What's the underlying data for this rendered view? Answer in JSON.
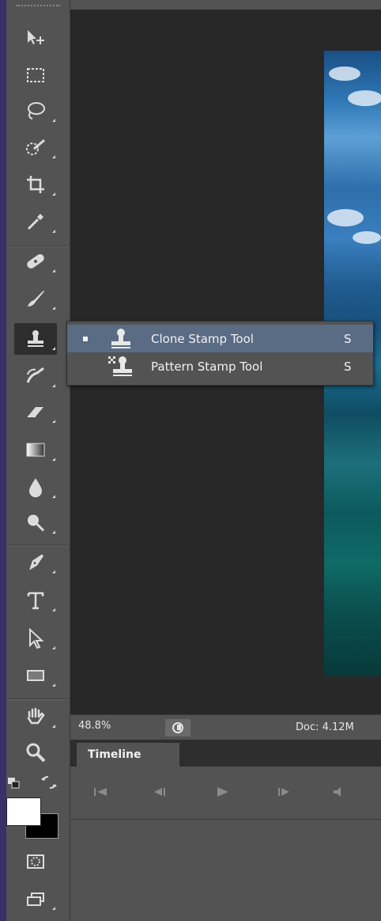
{
  "status": {
    "zoom": "48.8%",
    "doc_info": "Doc: 4.12M"
  },
  "timeline": {
    "tab_label": "Timeline"
  },
  "flyout": {
    "items": [
      {
        "label": "Clone Stamp Tool",
        "shortcut": "S",
        "selected": true
      },
      {
        "label": "Pattern Stamp Tool",
        "shortcut": "S",
        "selected": false
      }
    ]
  },
  "toolbar": {
    "tools": [
      "move-tool",
      "rectangular-marquee-tool",
      "lasso-tool",
      "quick-selection-tool",
      "crop-tool",
      "eyedropper-tool",
      "spot-healing-brush-tool",
      "brush-tool",
      "clone-stamp-tool",
      "history-brush-tool",
      "eraser-tool",
      "gradient-tool",
      "blur-tool",
      "dodge-tool",
      "pen-tool",
      "type-tool",
      "path-selection-tool",
      "rectangle-tool",
      "hand-tool",
      "zoom-tool"
    ]
  },
  "colors": {
    "foreground": "#ffffff",
    "background": "#000000",
    "flyout_highlight": "#5a6b84"
  }
}
